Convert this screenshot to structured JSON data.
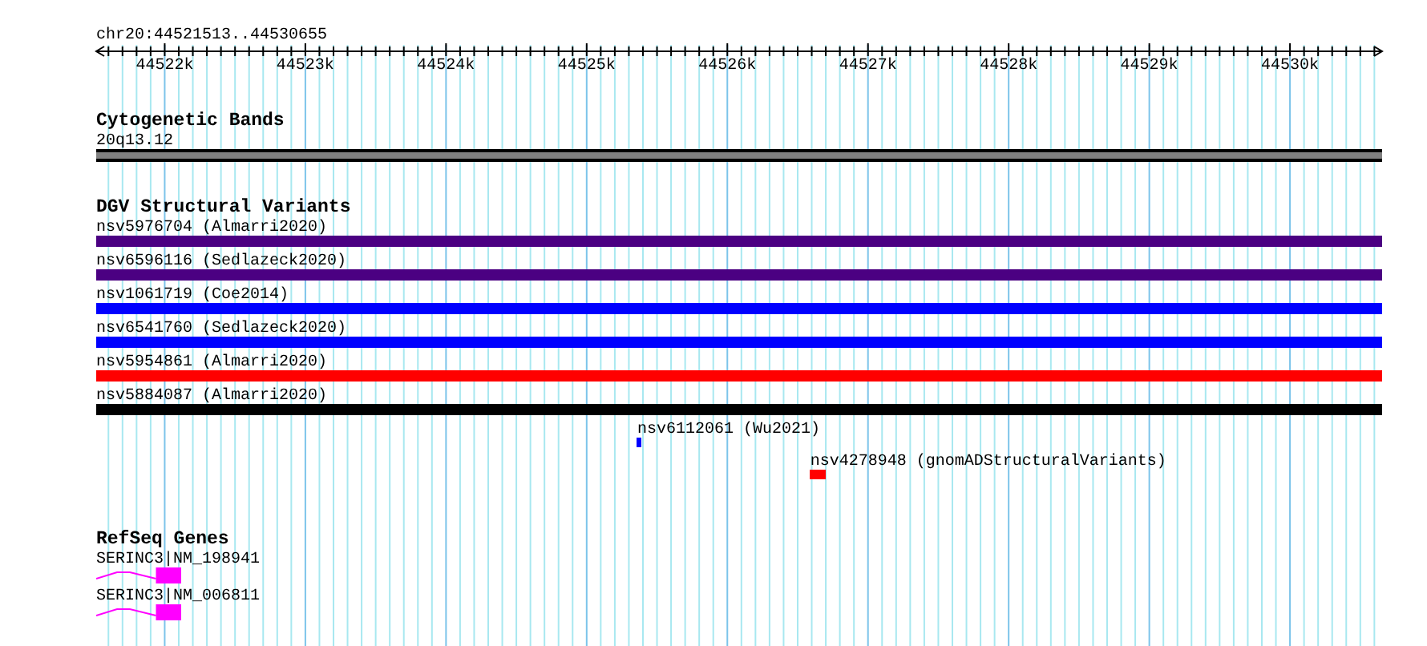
{
  "location": "chr20:44521513..44530655",
  "ruler": {
    "ticks": [
      "44522k",
      "44523k",
      "44524k",
      "44525k",
      "44526k",
      "44527k",
      "44528k",
      "44529k",
      "44530k"
    ]
  },
  "tracks": [
    {
      "title": "Cytogenetic Bands",
      "features": [
        {
          "label": "20q13.12",
          "kind": "band",
          "color": "#808080"
        }
      ]
    },
    {
      "title": "DGV Structural Variants",
      "features": [
        {
          "label": "nsv5976704 (Almarri2020)",
          "kind": "bar",
          "color": "#4b0082"
        },
        {
          "label": "nsv6596116 (Sedlazeck2020)",
          "kind": "bar",
          "color": "#4b0082"
        },
        {
          "label": "nsv1061719 (Coe2014)",
          "kind": "bar",
          "color": "#0000ff"
        },
        {
          "label": "nsv6541760 (Sedlazeck2020)",
          "kind": "bar",
          "color": "#0000ff"
        },
        {
          "label": "nsv5954861 (Almarri2020)",
          "kind": "bar",
          "color": "#ff0000"
        },
        {
          "label": "nsv5884087 (Almarri2020)",
          "kind": "bar",
          "color": "#000000"
        },
        {
          "label": "nsv6112061 (Wu2021)",
          "kind": "bar",
          "color": "#0000ff"
        },
        {
          "label": "nsv4278948 (gnomADStructuralVariants)",
          "kind": "bar",
          "color": "#ff0000"
        }
      ]
    },
    {
      "title": "RefSeq Genes",
      "features": [
        {
          "label": "SERINC3|NM_198941",
          "kind": "gene",
          "color": "#ff00ff"
        },
        {
          "label": "SERINC3|NM_006811",
          "kind": "gene",
          "color": "#ff00ff"
        }
      ]
    }
  ]
}
